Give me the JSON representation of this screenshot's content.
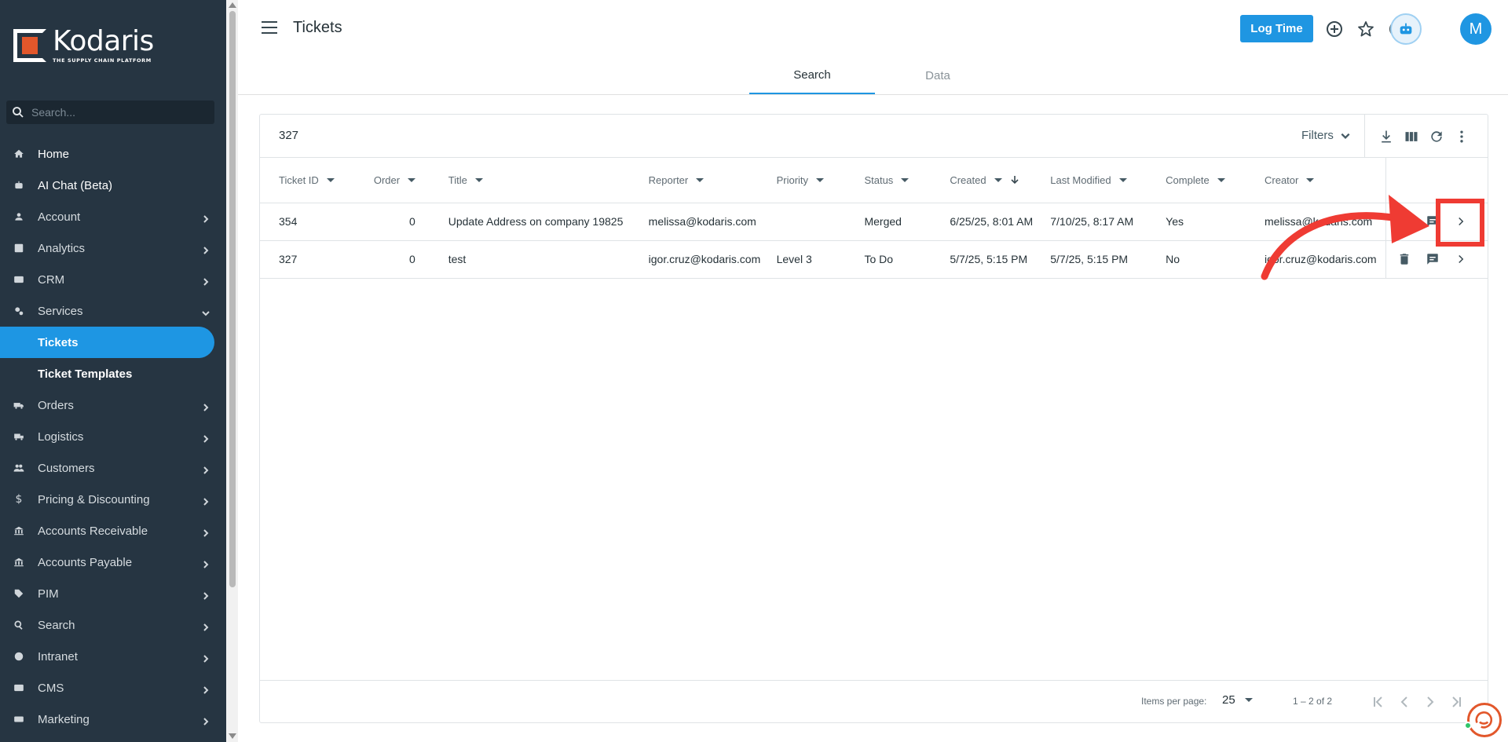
{
  "sidebar": {
    "logo": {
      "name": "Kodaris",
      "tagline": "THE SUPPLY CHAIN PLATFORM"
    },
    "search_placeholder": "Search...",
    "items": [
      {
        "label": "Home",
        "icon": "home-icon",
        "chevron": false
      },
      {
        "label": "AI Chat (Beta)",
        "icon": "robot-icon",
        "chevron": false
      },
      {
        "label": "Account",
        "icon": "person-icon",
        "chevron": true
      },
      {
        "label": "Analytics",
        "icon": "analytics-icon",
        "chevron": true
      },
      {
        "label": "CRM",
        "icon": "contact-card-icon",
        "chevron": true
      },
      {
        "label": "Services",
        "icon": "gears-icon",
        "chevron": "down"
      },
      {
        "label": "Orders",
        "icon": "truck-icon",
        "chevron": true
      },
      {
        "label": "Logistics",
        "icon": "shipping-icon",
        "chevron": true
      },
      {
        "label": "Customers",
        "icon": "people-icon",
        "chevron": true
      },
      {
        "label": "Pricing & Discounting",
        "icon": "dollar-icon",
        "chevron": true
      },
      {
        "label": "Accounts Receivable",
        "icon": "bank-icon",
        "chevron": true
      },
      {
        "label": "Accounts Payable",
        "icon": "bank-icon",
        "chevron": true
      },
      {
        "label": "PIM",
        "icon": "tag-icon",
        "chevron": true
      },
      {
        "label": "Search",
        "icon": "search-icon",
        "chevron": true
      },
      {
        "label": "Intranet",
        "icon": "globe-icon",
        "chevron": true
      },
      {
        "label": "CMS",
        "icon": "cms-icon",
        "chevron": true
      },
      {
        "label": "Marketing",
        "icon": "marketing-icon",
        "chevron": true
      }
    ],
    "sub_items": [
      {
        "label": "Tickets",
        "active": true
      },
      {
        "label": "Ticket Templates",
        "active": false
      }
    ]
  },
  "header": {
    "title": "Tickets",
    "log_time_label": "Log Time",
    "avatar_initial": "M"
  },
  "tabs": [
    {
      "label": "Search",
      "active": true
    },
    {
      "label": "Data",
      "active": false
    }
  ],
  "toolbar": {
    "count": "327",
    "filters_label": "Filters"
  },
  "table": {
    "columns": [
      "Ticket ID",
      "Order",
      "Title",
      "Reporter",
      "Priority",
      "Status",
      "Created",
      "Last Modified",
      "Complete",
      "Creator"
    ],
    "rows": [
      {
        "ticket_id": "354",
        "order": "0",
        "title": "Update Address on company 19825",
        "reporter": "melissa@kodaris.com",
        "priority": "",
        "status": "Merged",
        "created": "6/25/25, 8:01 AM",
        "last_modified": "7/10/25, 8:17 AM",
        "complete": "Yes",
        "creator": "melissa@kodaris.com"
      },
      {
        "ticket_id": "327",
        "order": "0",
        "title": "test",
        "reporter": "igor.cruz@kodaris.com",
        "priority": "Level 3",
        "status": "To Do",
        "created": "5/7/25, 5:15 PM",
        "last_modified": "5/7/25, 5:15 PM",
        "complete": "No",
        "creator": "igor.cruz@kodaris.com"
      }
    ]
  },
  "footer": {
    "items_per_page_label": "Items per page:",
    "items_per_page_value": "25",
    "range_label": "1 – 2 of 2"
  },
  "colors": {
    "sidebar_bg": "#263542",
    "accent": "#1f96e2",
    "brand_orange": "#e2572b",
    "annotation_red": "#ef3b33"
  }
}
